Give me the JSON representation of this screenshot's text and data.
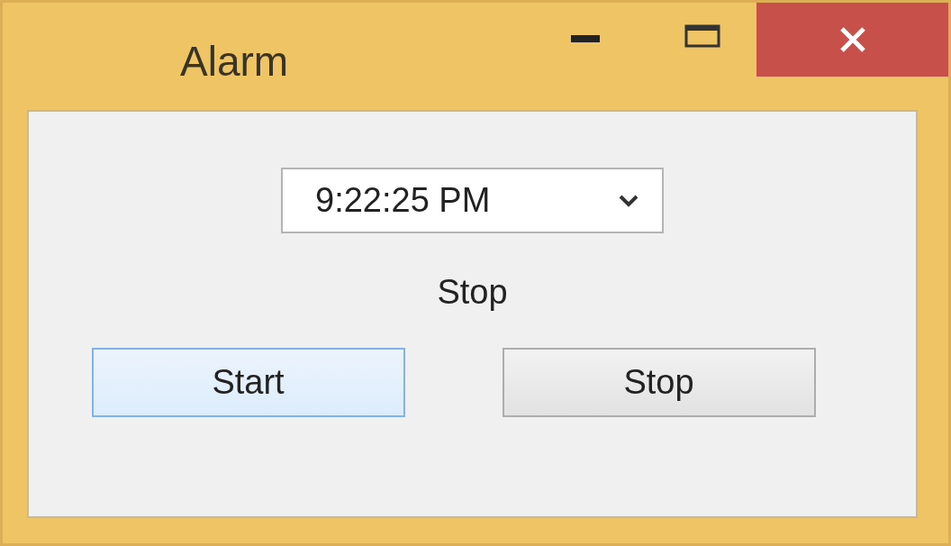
{
  "window": {
    "title": "Alarm"
  },
  "time_picker": {
    "value": "9:22:25 PM"
  },
  "status_label": "Stop",
  "buttons": [
    {
      "label": "Start",
      "focused": true
    },
    {
      "label": "Stop",
      "focused": false
    }
  ]
}
